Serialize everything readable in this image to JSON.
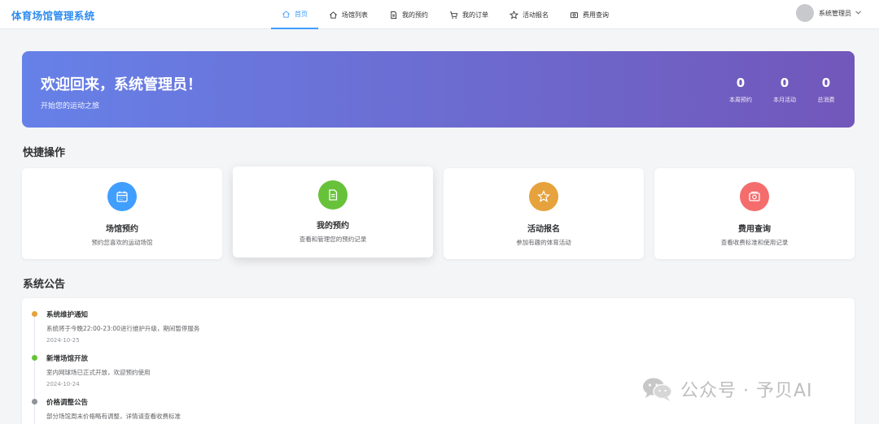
{
  "app": {
    "title": "体育场馆管理系统"
  },
  "nav": {
    "items": [
      {
        "label": "首页",
        "icon": "home-icon",
        "active": true
      },
      {
        "label": "场馆列表",
        "icon": "house-icon",
        "active": false
      },
      {
        "label": "我的预约",
        "icon": "document-icon",
        "active": false
      },
      {
        "label": "我的订单",
        "icon": "cart-icon",
        "active": false
      },
      {
        "label": "活动报名",
        "icon": "star-icon",
        "active": false
      },
      {
        "label": "费用查询",
        "icon": "money-icon",
        "active": false
      }
    ]
  },
  "user": {
    "name": "系统管理员",
    "icon": "chevron-down-icon"
  },
  "banner": {
    "title": "欢迎回来，系统管理员！",
    "subtitle": "开始您的运动之旅",
    "stats": [
      {
        "value": "0",
        "label": "本周预约"
      },
      {
        "value": "0",
        "label": "本月活动"
      },
      {
        "value": "0",
        "label": "总消费"
      }
    ],
    "gradient_start": "#6681e8",
    "gradient_end": "#7257ba"
  },
  "quick": {
    "title": "快捷操作",
    "cards": [
      {
        "title": "场馆预约",
        "desc": "预约您喜欢的运动场馆",
        "icon": "calendar-icon",
        "color": "#409eff"
      },
      {
        "title": "我的预约",
        "desc": "查看和管理您的预约记录",
        "icon": "document-icon",
        "color": "#67c23a"
      },
      {
        "title": "活动报名",
        "desc": "参加有趣的体育活动",
        "icon": "star-icon",
        "color": "#e6a23c"
      },
      {
        "title": "费用查询",
        "desc": "查看收费标准和使用记录",
        "icon": "money-icon",
        "color": "#f56c6c"
      }
    ]
  },
  "notices": {
    "title": "系统公告",
    "items": [
      {
        "title": "系统维护通知",
        "text": "系统将于今晚22:00-23:00进行维护升级，期间暂停服务",
        "date": "2024-10-25",
        "color": "#e6a23c"
      },
      {
        "title": "新增场馆开放",
        "text": "室内网球场已正式开放，欢迎预约使用",
        "date": "2024-10-24",
        "color": "#67c23a"
      },
      {
        "title": "价格调整公告",
        "text": "部分场馆周末价格略有调整，详情请查看收费标准",
        "date": "",
        "color": "#909399"
      }
    ]
  },
  "watermark": {
    "text": "公众号 · 予贝AI"
  }
}
